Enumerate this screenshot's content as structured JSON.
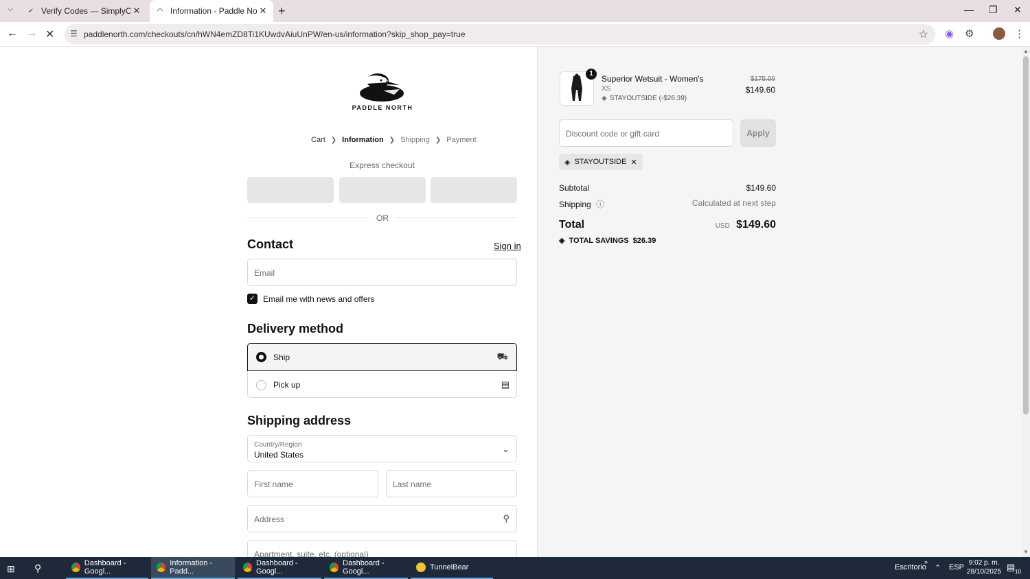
{
  "browser": {
    "tabs": [
      {
        "title": "Verify Codes — SimplyCodes",
        "active": false
      },
      {
        "title": "Information - Paddle North - Ch",
        "active": true
      }
    ],
    "url": "paddlenorth.com/checkouts/cn/hWN4emZD8Ti1KUwdvAiuUnPW/en-us/information?skip_shop_pay=true"
  },
  "checkout": {
    "brand": "PADDLE NORTH",
    "breadcrumb": {
      "cart": "Cart",
      "information": "Information",
      "shipping": "Shipping",
      "payment": "Payment"
    },
    "express_checkout": "Express checkout",
    "or": "OR",
    "contact": {
      "heading": "Contact",
      "sign_in": "Sign in",
      "email_placeholder": "Email",
      "newsletter_label": "Email me with news and offers",
      "newsletter_checked": true
    },
    "delivery": {
      "heading": "Delivery method",
      "ship": "Ship",
      "pickup": "Pick up",
      "selected": "Ship"
    },
    "shipping_address": {
      "heading": "Shipping address",
      "country_label": "Country/Region",
      "country_value": "United States",
      "first_name": "First name",
      "last_name": "Last name",
      "address": "Address",
      "apartment": "Apartment, suite, etc. (optional)"
    }
  },
  "summary": {
    "product": {
      "name": "Superior Wetsuit - Women's",
      "variant": "XS",
      "discount": "STAYOUTSIDE (-$26.39)",
      "quantity": "1",
      "original_price": "$175.99",
      "price": "$149.60"
    },
    "discount_placeholder": "Discount code or gift card",
    "apply": "Apply",
    "applied_code": "STAYOUTSIDE",
    "subtotal_label": "Subtotal",
    "subtotal": "$149.60",
    "shipping_label": "Shipping",
    "shipping": "Calculated at next step",
    "total_label": "Total",
    "currency": "USD",
    "total": "$149.60",
    "savings_label": "TOTAL SAVINGS",
    "savings": "$26.39"
  },
  "taskbar": {
    "items": [
      "Dashboard - Googl...",
      "Information - Padd...",
      "Dashboard - Googl...",
      "Dashboard - Googl...",
      "TunnelBear"
    ],
    "desktop": "Escritorio",
    "lang": "ESP",
    "time": "9:02 p. m.",
    "date": "28/10/2025",
    "notifications": "10"
  },
  "colors": {
    "accent": "#111111",
    "right_pane_bg": "#f5f5f5",
    "taskbar_bg": "#1e2a3a"
  }
}
